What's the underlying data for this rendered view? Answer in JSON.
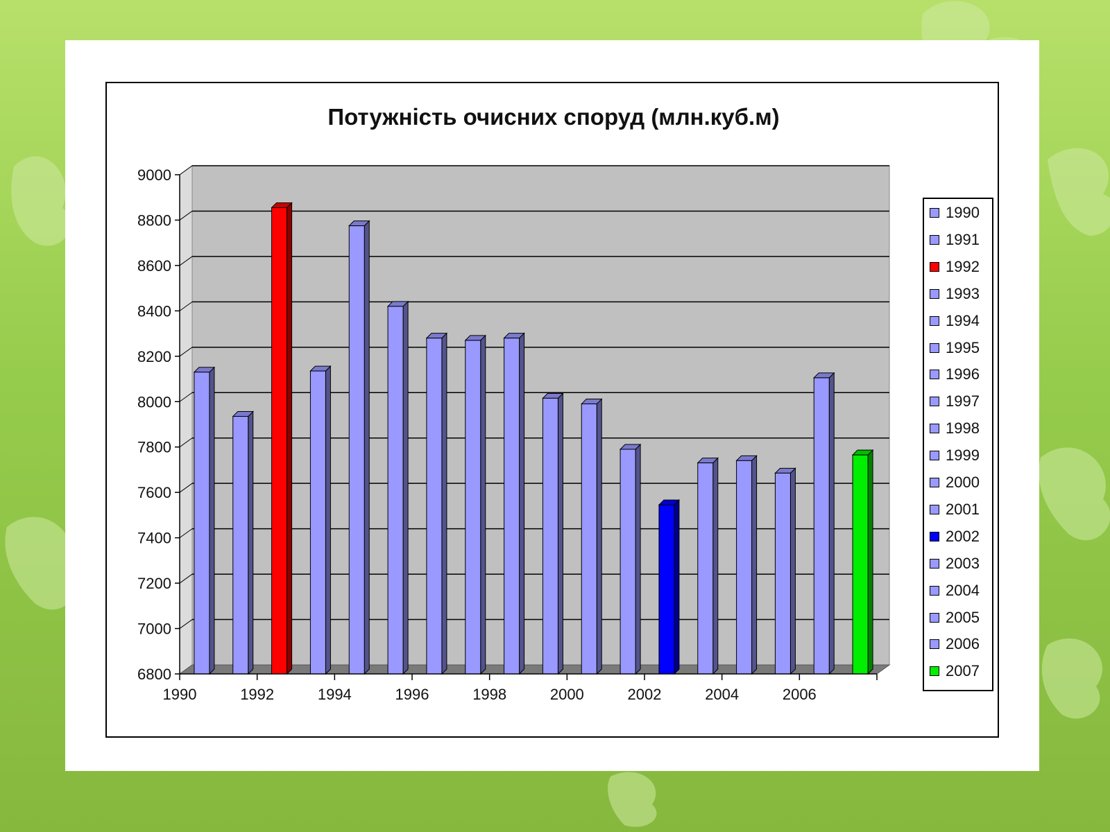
{
  "colors": {
    "bar_default": "#9999ff",
    "bar_max": "#ff0000",
    "bar_min": "#0000ff",
    "bar_last": "#00ee00",
    "plot_bg": "#c0c0c0"
  },
  "chart_data": {
    "type": "bar",
    "title": "Потужність очисних споруд (млн.куб.м)",
    "xlabel": "",
    "ylabel": "",
    "categories": [
      "1990",
      "1991",
      "1992",
      "1993",
      "1994",
      "1995",
      "1996",
      "1997",
      "1998",
      "1999",
      "2000",
      "2001",
      "2002",
      "2003",
      "2004",
      "2005",
      "2006",
      "2007"
    ],
    "values": [
      8130,
      7935,
      8855,
      8135,
      8775,
      8420,
      8280,
      8270,
      8280,
      8015,
      7990,
      7790,
      7545,
      7730,
      7740,
      7685,
      8105,
      7765
    ],
    "bar_colors": [
      "#9999ff",
      "#9999ff",
      "#ff0000",
      "#9999ff",
      "#9999ff",
      "#9999ff",
      "#9999ff",
      "#9999ff",
      "#9999ff",
      "#9999ff",
      "#9999ff",
      "#9999ff",
      "#0000ff",
      "#9999ff",
      "#9999ff",
      "#9999ff",
      "#9999ff",
      "#00ee00"
    ],
    "ylim": [
      6800,
      9000
    ],
    "yticks": [
      "6800",
      "7000",
      "7200",
      "7400",
      "7600",
      "7800",
      "8000",
      "8200",
      "8400",
      "8600",
      "8800",
      "9000"
    ],
    "xtick_labels": [
      "1990",
      "1992",
      "1994",
      "1996",
      "1998",
      "2000",
      "2002",
      "2004",
      "2006"
    ],
    "grid": true,
    "legend": "right"
  }
}
